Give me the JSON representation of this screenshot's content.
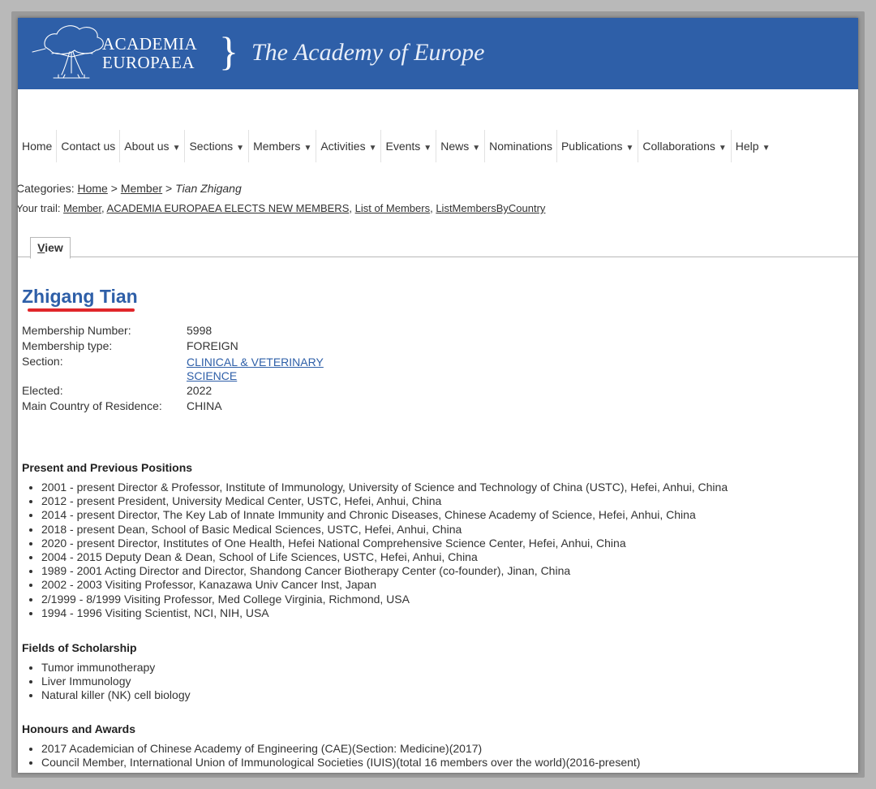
{
  "header": {
    "logo_line1": "ACADEMIA",
    "logo_line2": "EUROPAEA",
    "logo_brace": "}",
    "tagline": "The Academy of Europe",
    "bg_color": "#2e5fa8"
  },
  "nav": [
    {
      "label": "Home",
      "dropdown": false
    },
    {
      "label": "Contact us",
      "dropdown": false
    },
    {
      "label": "About us",
      "dropdown": true
    },
    {
      "label": "Sections",
      "dropdown": true
    },
    {
      "label": "Members",
      "dropdown": true
    },
    {
      "label": "Activities",
      "dropdown": true
    },
    {
      "label": "Events",
      "dropdown": true
    },
    {
      "label": "News",
      "dropdown": true
    },
    {
      "label": "Nominations",
      "dropdown": false
    },
    {
      "label": "Publications",
      "dropdown": true
    },
    {
      "label": "Collaborations",
      "dropdown": true
    },
    {
      "label": "Help",
      "dropdown": true
    }
  ],
  "breadcrumb": {
    "prefix": "Categories: ",
    "home": "Home",
    "sep1": " > ",
    "member": "Member",
    "sep2": " > ",
    "current": "Tian Zhigang"
  },
  "trail": {
    "prefix": "Your trail: ",
    "links": [
      "Member",
      "ACADEMIA EUROPAEA ELECTS NEW MEMBERS",
      "List of Members",
      "ListMembersByCountry"
    ]
  },
  "tab": {
    "first": "V",
    "rest": "iew"
  },
  "profile": {
    "name": "Zhigang Tian",
    "fields": {
      "number_label": "Membership Number:",
      "number": "5998",
      "type_label": "Membership type:",
      "type": "FOREIGN",
      "section_label": "Section:",
      "section_line1": "CLINICAL & VETERINARY",
      "section_line2": "SCIENCE",
      "elected_label": "Elected:",
      "elected": "2022",
      "country_label": "Main Country of Residence:",
      "country": "CHINA"
    }
  },
  "positions": {
    "title": "Present and Previous Positions",
    "items": [
      "2001 - present Director & Professor, Institute of Immunology, University of Science and Technology of China (USTC), Hefei, Anhui, China",
      "2012 - present President, University Medical Center, USTC, Hefei, Anhui, China",
      "2014 - present Director, The Key Lab of Innate Immunity and Chronic Diseases, Chinese Academy of Science, Hefei, Anhui, China",
      "2018 - present Dean, School of Basic Medical Sciences, USTC, Hefei, Anhui, China",
      "2020 - present Director, Institutes of One Health, Hefei National Comprehensive Science Center, Hefei, Anhui, China",
      "2004 - 2015 Deputy Dean & Dean, School of Life Sciences, USTC, Hefei, Anhui, China",
      "1989 - 2001 Acting Director and Director, Shandong Cancer Biotherapy Center (co-founder), Jinan, China",
      "2002 - 2003 Visiting Professor, Kanazawa Univ Cancer Inst, Japan",
      "2/1999 - 8/1999 Visiting Professor, Med College Virginia, Richmond, USA",
      "1994 - 1996 Visiting Scientist, NCI, NIH, USA"
    ]
  },
  "fields_of_scholarship": {
    "title": "Fields of Scholarship",
    "items": [
      "Tumor immunotherapy",
      "Liver Immunology",
      "Natural killer (NK) cell biology"
    ]
  },
  "honours": {
    "title": "Honours and Awards",
    "items": [
      "2017 Academician of Chinese Academy of Engineering (CAE)(Section: Medicine)(2017)",
      "Council Member, International Union of Immunological Societies (IUIS)(total 16 members over the world)(2016-present)"
    ]
  },
  "colors": {
    "link_blue": "#2e5fa8",
    "annotation_red": "#e0262a"
  }
}
